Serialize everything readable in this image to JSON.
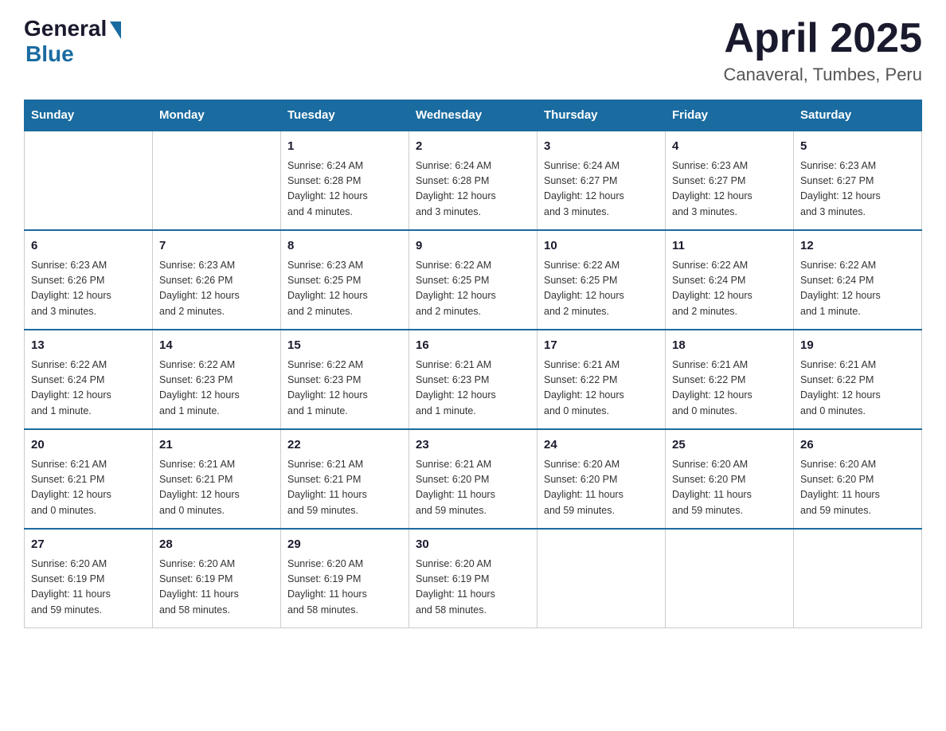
{
  "logo": {
    "general": "General",
    "blue": "Blue"
  },
  "title": "April 2025",
  "subtitle": "Canaveral, Tumbes, Peru",
  "days_of_week": [
    "Sunday",
    "Monday",
    "Tuesday",
    "Wednesday",
    "Thursday",
    "Friday",
    "Saturday"
  ],
  "weeks": [
    [
      {
        "day": "",
        "info": ""
      },
      {
        "day": "",
        "info": ""
      },
      {
        "day": "1",
        "info": "Sunrise: 6:24 AM\nSunset: 6:28 PM\nDaylight: 12 hours\nand 4 minutes."
      },
      {
        "day": "2",
        "info": "Sunrise: 6:24 AM\nSunset: 6:28 PM\nDaylight: 12 hours\nand 3 minutes."
      },
      {
        "day": "3",
        "info": "Sunrise: 6:24 AM\nSunset: 6:27 PM\nDaylight: 12 hours\nand 3 minutes."
      },
      {
        "day": "4",
        "info": "Sunrise: 6:23 AM\nSunset: 6:27 PM\nDaylight: 12 hours\nand 3 minutes."
      },
      {
        "day": "5",
        "info": "Sunrise: 6:23 AM\nSunset: 6:27 PM\nDaylight: 12 hours\nand 3 minutes."
      }
    ],
    [
      {
        "day": "6",
        "info": "Sunrise: 6:23 AM\nSunset: 6:26 PM\nDaylight: 12 hours\nand 3 minutes."
      },
      {
        "day": "7",
        "info": "Sunrise: 6:23 AM\nSunset: 6:26 PM\nDaylight: 12 hours\nand 2 minutes."
      },
      {
        "day": "8",
        "info": "Sunrise: 6:23 AM\nSunset: 6:25 PM\nDaylight: 12 hours\nand 2 minutes."
      },
      {
        "day": "9",
        "info": "Sunrise: 6:22 AM\nSunset: 6:25 PM\nDaylight: 12 hours\nand 2 minutes."
      },
      {
        "day": "10",
        "info": "Sunrise: 6:22 AM\nSunset: 6:25 PM\nDaylight: 12 hours\nand 2 minutes."
      },
      {
        "day": "11",
        "info": "Sunrise: 6:22 AM\nSunset: 6:24 PM\nDaylight: 12 hours\nand 2 minutes."
      },
      {
        "day": "12",
        "info": "Sunrise: 6:22 AM\nSunset: 6:24 PM\nDaylight: 12 hours\nand 1 minute."
      }
    ],
    [
      {
        "day": "13",
        "info": "Sunrise: 6:22 AM\nSunset: 6:24 PM\nDaylight: 12 hours\nand 1 minute."
      },
      {
        "day": "14",
        "info": "Sunrise: 6:22 AM\nSunset: 6:23 PM\nDaylight: 12 hours\nand 1 minute."
      },
      {
        "day": "15",
        "info": "Sunrise: 6:22 AM\nSunset: 6:23 PM\nDaylight: 12 hours\nand 1 minute."
      },
      {
        "day": "16",
        "info": "Sunrise: 6:21 AM\nSunset: 6:23 PM\nDaylight: 12 hours\nand 1 minute."
      },
      {
        "day": "17",
        "info": "Sunrise: 6:21 AM\nSunset: 6:22 PM\nDaylight: 12 hours\nand 0 minutes."
      },
      {
        "day": "18",
        "info": "Sunrise: 6:21 AM\nSunset: 6:22 PM\nDaylight: 12 hours\nand 0 minutes."
      },
      {
        "day": "19",
        "info": "Sunrise: 6:21 AM\nSunset: 6:22 PM\nDaylight: 12 hours\nand 0 minutes."
      }
    ],
    [
      {
        "day": "20",
        "info": "Sunrise: 6:21 AM\nSunset: 6:21 PM\nDaylight: 12 hours\nand 0 minutes."
      },
      {
        "day": "21",
        "info": "Sunrise: 6:21 AM\nSunset: 6:21 PM\nDaylight: 12 hours\nand 0 minutes."
      },
      {
        "day": "22",
        "info": "Sunrise: 6:21 AM\nSunset: 6:21 PM\nDaylight: 11 hours\nand 59 minutes."
      },
      {
        "day": "23",
        "info": "Sunrise: 6:21 AM\nSunset: 6:20 PM\nDaylight: 11 hours\nand 59 minutes."
      },
      {
        "day": "24",
        "info": "Sunrise: 6:20 AM\nSunset: 6:20 PM\nDaylight: 11 hours\nand 59 minutes."
      },
      {
        "day": "25",
        "info": "Sunrise: 6:20 AM\nSunset: 6:20 PM\nDaylight: 11 hours\nand 59 minutes."
      },
      {
        "day": "26",
        "info": "Sunrise: 6:20 AM\nSunset: 6:20 PM\nDaylight: 11 hours\nand 59 minutes."
      }
    ],
    [
      {
        "day": "27",
        "info": "Sunrise: 6:20 AM\nSunset: 6:19 PM\nDaylight: 11 hours\nand 59 minutes."
      },
      {
        "day": "28",
        "info": "Sunrise: 6:20 AM\nSunset: 6:19 PM\nDaylight: 11 hours\nand 58 minutes."
      },
      {
        "day": "29",
        "info": "Sunrise: 6:20 AM\nSunset: 6:19 PM\nDaylight: 11 hours\nand 58 minutes."
      },
      {
        "day": "30",
        "info": "Sunrise: 6:20 AM\nSunset: 6:19 PM\nDaylight: 11 hours\nand 58 minutes."
      },
      {
        "day": "",
        "info": ""
      },
      {
        "day": "",
        "info": ""
      },
      {
        "day": "",
        "info": ""
      }
    ]
  ]
}
